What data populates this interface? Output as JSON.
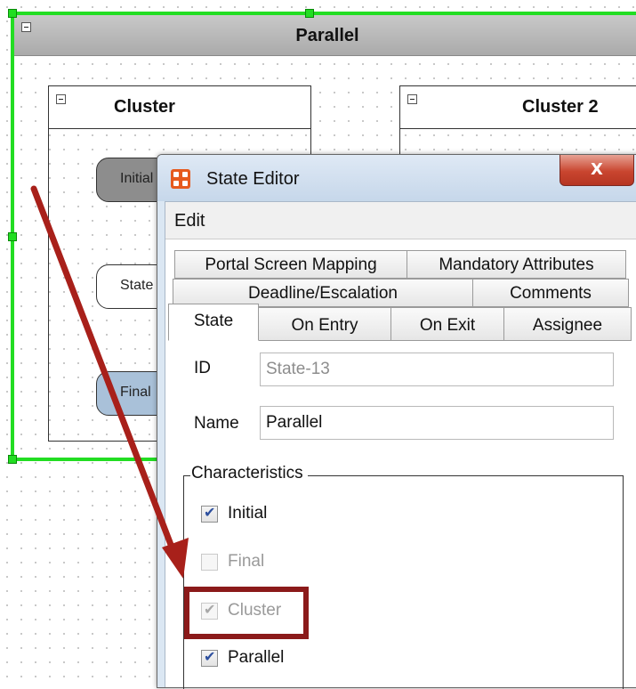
{
  "canvas": {
    "parallel_state": {
      "title": "Parallel"
    },
    "clusters": [
      {
        "title": "Cluster",
        "states": [
          "Initial",
          "State",
          "Final"
        ]
      },
      {
        "title": "Cluster 2"
      }
    ]
  },
  "dialog": {
    "title": "State Editor",
    "close_label": "X",
    "menu": {
      "edit": "Edit"
    },
    "tabs": {
      "row1": [
        "Portal Screen Mapping",
        "Mandatory Attributes"
      ],
      "row2": [
        "Deadline/Escalation",
        "Comments"
      ],
      "row3": [
        "State",
        "On Entry",
        "On Exit",
        "Assignee"
      ],
      "active": "State"
    },
    "form": {
      "id_label": "ID",
      "id_value": "State-13",
      "name_label": "Name",
      "name_value": "Parallel"
    },
    "characteristics": {
      "legend": "Characteristics",
      "options": [
        {
          "label": "Initial",
          "checked": true,
          "enabled": true
        },
        {
          "label": "Final",
          "checked": false,
          "enabled": false
        },
        {
          "label": "Cluster",
          "checked": true,
          "enabled": false
        },
        {
          "label": "Parallel",
          "checked": true,
          "enabled": true
        }
      ]
    }
  },
  "annotation": {
    "arrow_color": "#a8201a",
    "highlight_color": "#8b1a1a"
  },
  "colors": {
    "selection": "#22dd22",
    "dialog_frame": "#dbe7f3"
  }
}
